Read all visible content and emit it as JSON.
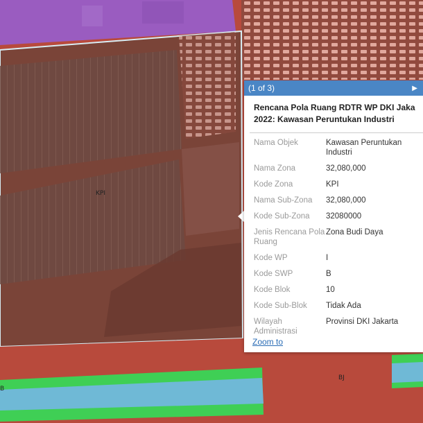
{
  "popup": {
    "pager": "(1 of 3)",
    "next_icon": "play-triangle-icon",
    "title_line1": "Rencana Pola Ruang RDTR WP DKI Jaka",
    "title_line2": "2022: Kawasan Peruntukan Industri",
    "zoom_label": "Zoom to",
    "attributes": [
      {
        "key": "Nama Objek",
        "value": "Kawasan Peruntukan Industri"
      },
      {
        "key": "Nama Zona",
        "value": "32,080,000"
      },
      {
        "key": "Kode Zona",
        "value": "KPI"
      },
      {
        "key": "Nama Sub-Zona",
        "value": "32,080,000"
      },
      {
        "key": "Kode Sub-Zona",
        "value": "32080000"
      },
      {
        "key": "Jenis Rencana Pola Ruang",
        "value": "Zona Budi Daya"
      },
      {
        "key": "Kode WP",
        "value": "I"
      },
      {
        "key": "Kode SWP",
        "value": "B"
      },
      {
        "key": "Kode Blok",
        "value": "10"
      },
      {
        "key": "Kode Sub-Blok",
        "value": "Tidak Ada"
      },
      {
        "key": "Wilayah Administrasi",
        "value": "Provinsi DKI Jakarta"
      }
    ]
  },
  "map": {
    "labels": {
      "kpi": "KPI",
      "bj": "BJ",
      "left_edge": "B"
    },
    "colors": {
      "industrial_zone": "#b84a3c",
      "selected_outline": "#d8eef5",
      "residential_zone": "#9a5cc0",
      "green_strip": "#3fcf55",
      "blue_strip": "#6fb9d6",
      "popup_header": "#4a86c5"
    }
  }
}
